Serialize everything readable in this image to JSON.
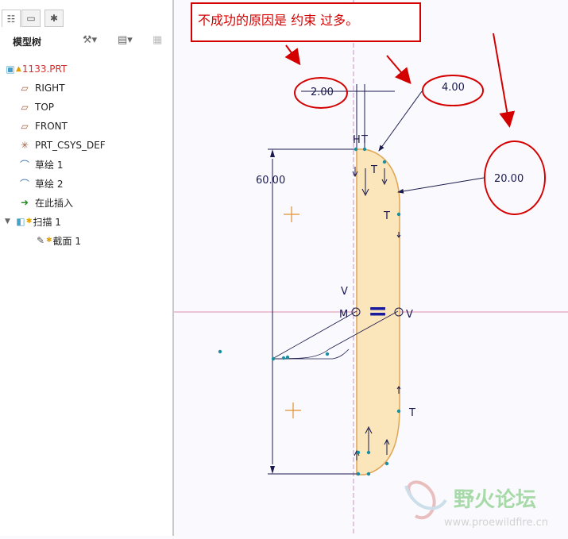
{
  "model_tree": {
    "title": "模型树",
    "items": [
      {
        "label": "1133.PRT",
        "icon": "part-icon"
      },
      {
        "label": "RIGHT",
        "icon": "datum-plane-icon"
      },
      {
        "label": "TOP",
        "icon": "datum-plane-icon"
      },
      {
        "label": "FRONT",
        "icon": "datum-plane-icon"
      },
      {
        "label": "PRT_CSYS_DEF",
        "icon": "csys-icon"
      },
      {
        "label": "草绘 1",
        "icon": "sketch-icon"
      },
      {
        "label": "草绘 2",
        "icon": "sketch-icon"
      },
      {
        "label": "在此插入",
        "icon": "insert-arrow-icon"
      },
      {
        "label": "扫描 1",
        "icon": "sweep-icon"
      },
      {
        "label": "截面 1",
        "icon": "section-icon"
      }
    ]
  },
  "annotation": {
    "text": "不成功的原因是  约束  过多。"
  },
  "dimensions": {
    "d1": "2.00",
    "d2": "4.00",
    "d3": "20.00",
    "d4": "60.00"
  },
  "constraints": {
    "h": "H",
    "t": "T",
    "v": "V",
    "m": "M",
    "eq": "="
  },
  "watermark": {
    "cn": "野火论坛",
    "url": "www.proewildfire.cn"
  },
  "colors": {
    "annotation": "#d40000",
    "profile_fill": "#fbe6bb",
    "profile_edge": "#e0a552",
    "dimension": "#1a1a4e",
    "centerline": "#e08fa8"
  }
}
